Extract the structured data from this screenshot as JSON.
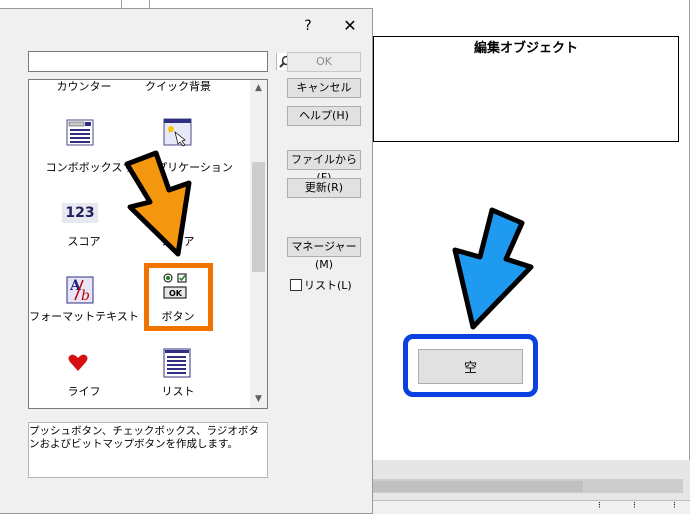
{
  "dialog": {
    "help_glyph": "?",
    "close_glyph": "✕",
    "search": {
      "value": "",
      "placeholder": ""
    },
    "list_items": {
      "counter": "カウンター",
      "quick_bg": "クイック背景",
      "combobox": "コンボボックス",
      "sub_app": "サブアプリケーション",
      "score": "スコア",
      "score_digits": "123",
      "score2": "スコア",
      "format_text": "フォーマットテキスト",
      "button": "ボタン",
      "button_icon_ok": "OK",
      "life": "ライフ",
      "list": "リスト"
    },
    "description": "プッシュボタン、チェックボックス、ラジオボタンおよびビットマップボタンを作成します。",
    "buttons": {
      "ok": "OK",
      "cancel": "キャンセル",
      "help": "ヘルプ(H)",
      "from_file": "ファイルから(F)",
      "update": "更新(R)",
      "manager": "マネージャー(M)"
    },
    "list_checkbox_label": "リスト(L)"
  },
  "background": {
    "edit_object_title": "編集オブジェクト",
    "empty_button": "空",
    "left_strip_glyph": ">"
  },
  "colors": {
    "orange_arrow": "#f5960f",
    "orange_highlight": "#f07300",
    "blue_arrow": "#1e9bf0",
    "blue_highlight": "#0a3fe0"
  }
}
